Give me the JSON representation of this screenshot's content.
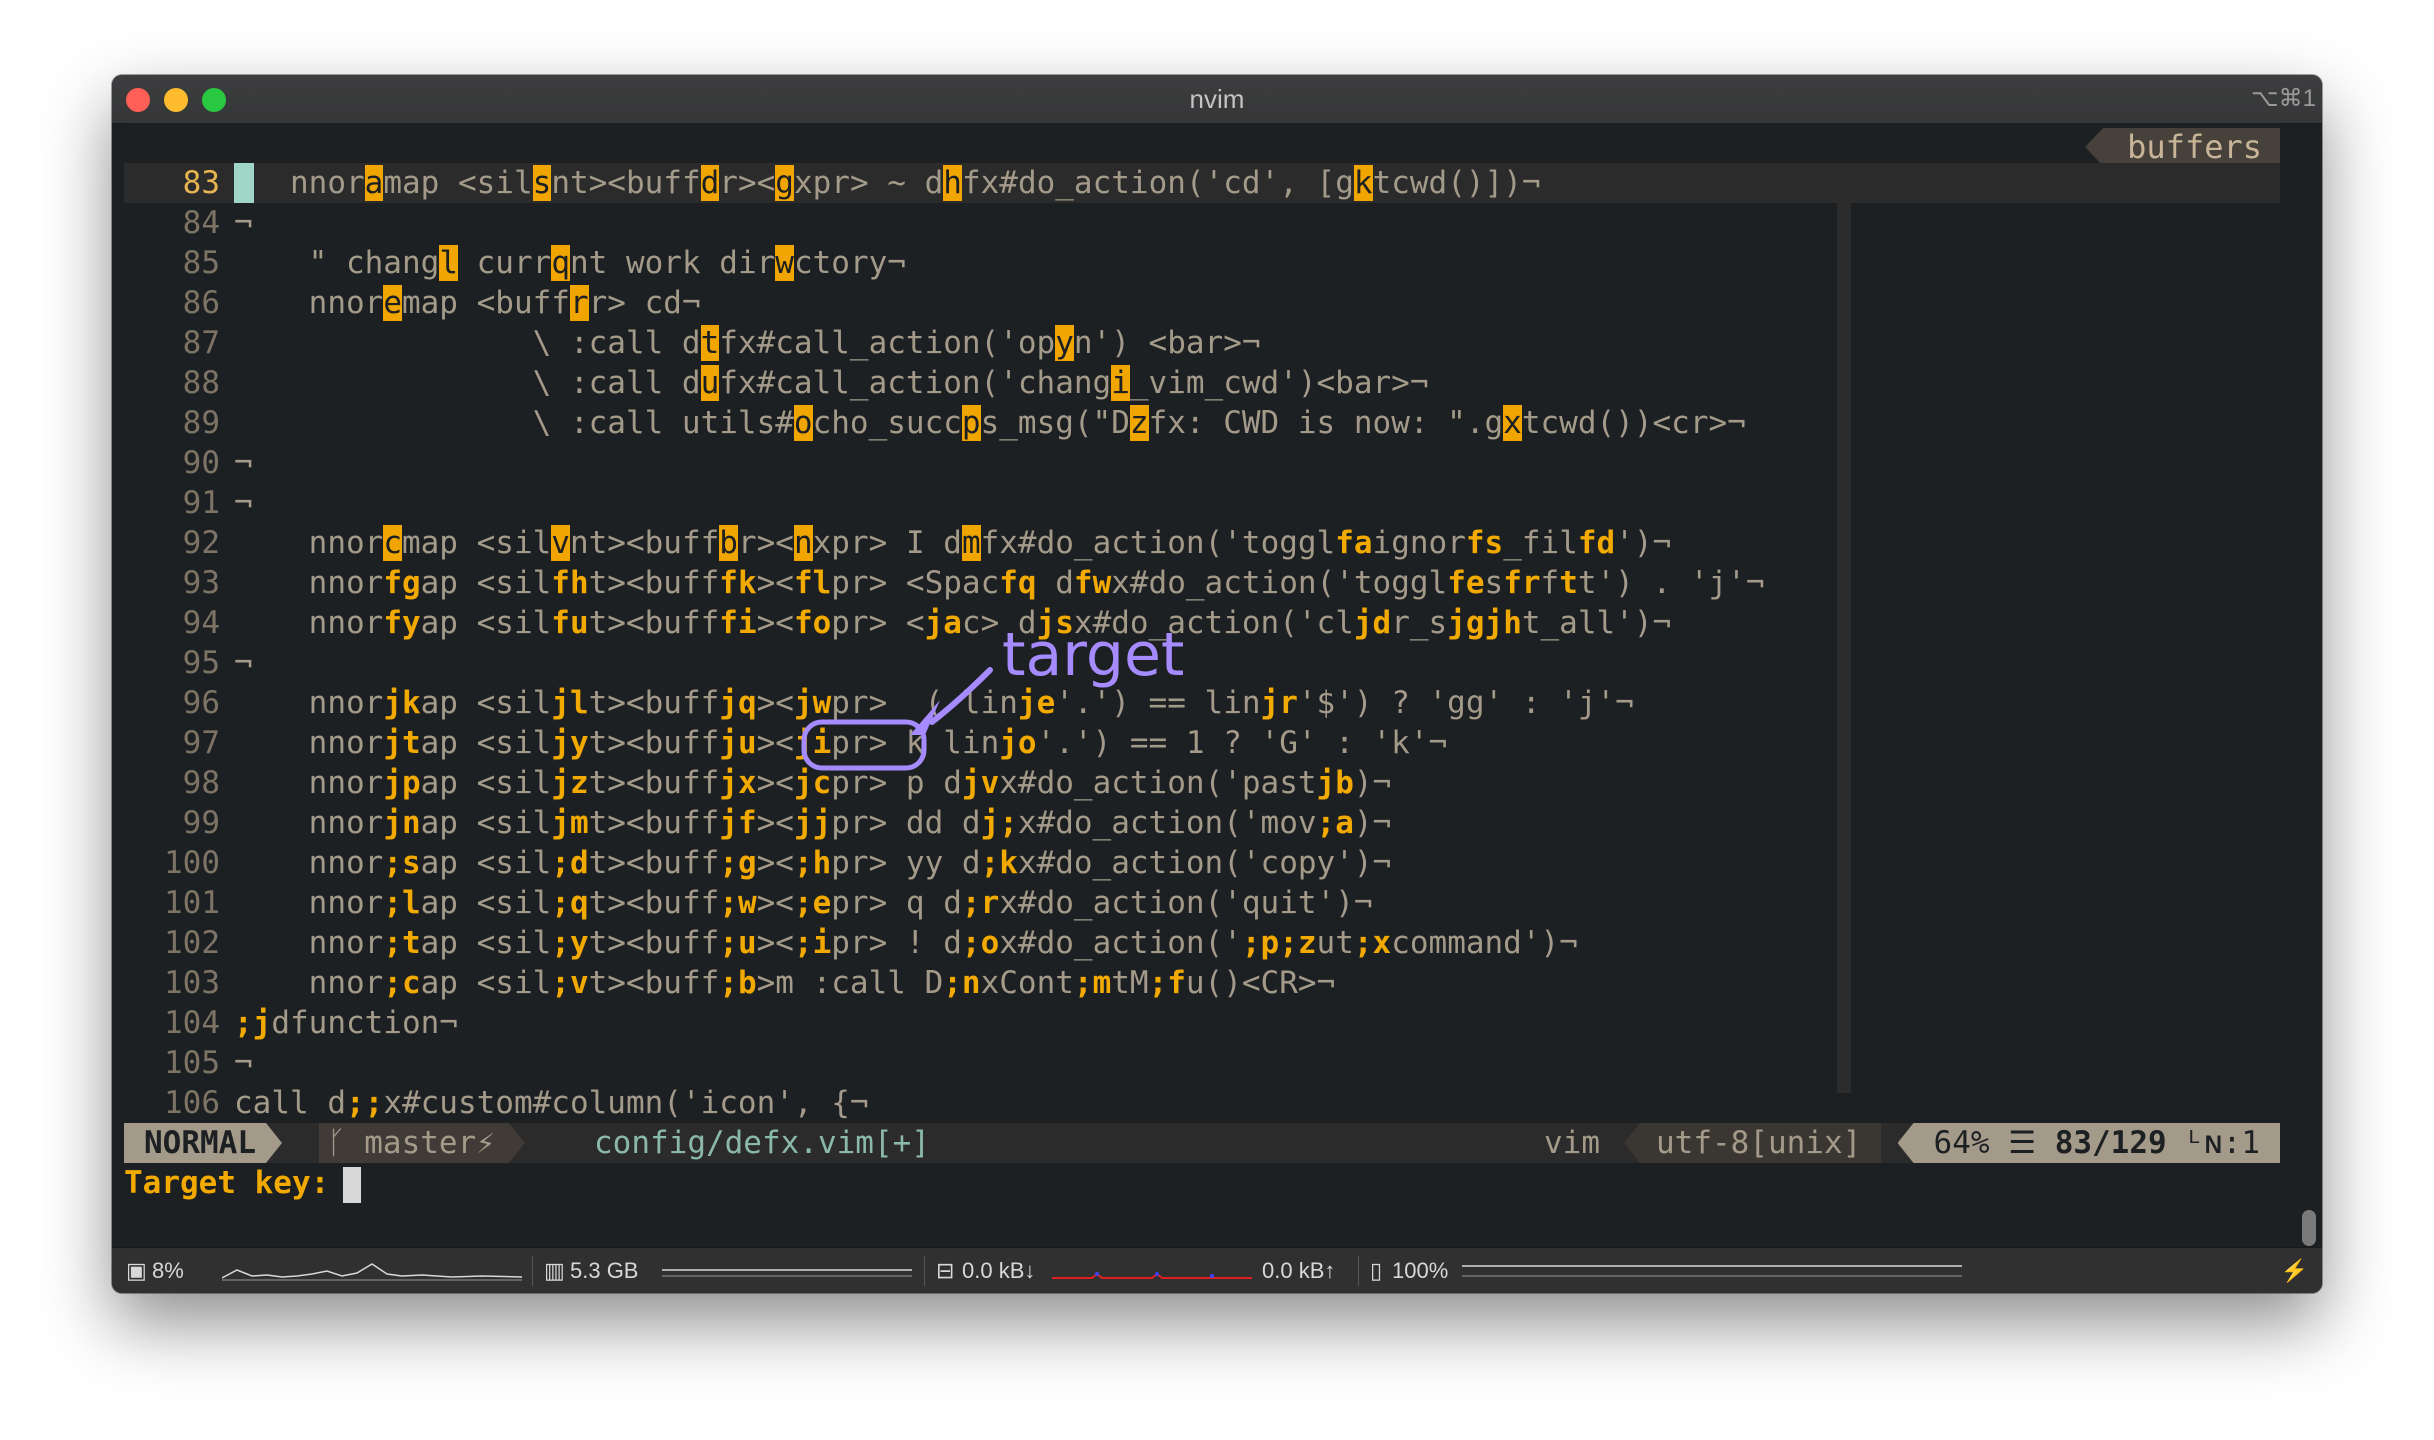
{
  "window": {
    "title": "nvim",
    "shortcut": "⌥⌘1",
    "traffic_lights": {
      "close": "#ff5f57",
      "minimize": "#febc2e",
      "maximize": "#28c840"
    }
  },
  "tabline": {
    "buffers_label": "buffers"
  },
  "editor": {
    "lines": [
      {
        "n": "83",
        "current": true,
        "segs": [
          [
            "   nnor",
            ""
          ],
          [
            "a",
            "hl"
          ],
          [
            "map ",
            ""
          ],
          [
            "<sil",
            ""
          ],
          [
            "s",
            "hl"
          ],
          [
            "nt><buff",
            ""
          ],
          [
            "d",
            "hl"
          ],
          [
            "r><",
            ""
          ],
          [
            "g",
            "hl"
          ],
          [
            "xpr> ~ d",
            ""
          ],
          [
            "h",
            "hl"
          ],
          [
            "fx#do_action('cd', [g",
            ""
          ],
          [
            "k",
            "hl"
          ],
          [
            "tcwd()])¬",
            ""
          ]
        ]
      },
      {
        "n": "84",
        "segs": [
          [
            "¬",
            ""
          ]
        ]
      },
      {
        "n": "85",
        "segs": [
          [
            "    \" chang",
            ""
          ],
          [
            "l",
            "hl"
          ],
          [
            " curr",
            ""
          ],
          [
            "q",
            "hl"
          ],
          [
            "nt work dir",
            ""
          ],
          [
            "w",
            "hl"
          ],
          [
            "ctory¬",
            ""
          ]
        ]
      },
      {
        "n": "86",
        "segs": [
          [
            "    nnor",
            ""
          ],
          [
            "e",
            "hl"
          ],
          [
            "map <buff",
            ""
          ],
          [
            "r",
            "hl"
          ],
          [
            "r> cd¬",
            ""
          ]
        ]
      },
      {
        "n": "87",
        "segs": [
          [
            "                \\ :call d",
            ""
          ],
          [
            "t",
            "hl"
          ],
          [
            "fx#call_action('op",
            ""
          ],
          [
            "y",
            "hl"
          ],
          [
            "n') <bar>¬",
            ""
          ]
        ]
      },
      {
        "n": "88",
        "segs": [
          [
            "                \\ :call d",
            ""
          ],
          [
            "u",
            "hl"
          ],
          [
            "fx#call_action('chang",
            ""
          ],
          [
            "i",
            "hl"
          ],
          [
            "_vim_cwd')<bar>¬",
            ""
          ]
        ]
      },
      {
        "n": "89",
        "segs": [
          [
            "                \\ :call utils#",
            ""
          ],
          [
            "o",
            "hl"
          ],
          [
            "cho_succ",
            ""
          ],
          [
            "p",
            "hl"
          ],
          [
            "s_msg(\"D",
            ""
          ],
          [
            "z",
            "hl"
          ],
          [
            "fx: CWD is now: \".g",
            ""
          ],
          [
            "x",
            "hl"
          ],
          [
            "tcwd())<cr>¬",
            ""
          ]
        ]
      },
      {
        "n": "90",
        "segs": [
          [
            "¬",
            ""
          ]
        ]
      },
      {
        "n": "91",
        "segs": [
          [
            "¬",
            ""
          ]
        ]
      },
      {
        "n": "92",
        "segs": [
          [
            "    nnor",
            ""
          ],
          [
            "c",
            "hl"
          ],
          [
            "map <sil",
            ""
          ],
          [
            "v",
            "hl"
          ],
          [
            "nt><buff",
            ""
          ],
          [
            "b",
            "hl"
          ],
          [
            "r><",
            ""
          ],
          [
            "n",
            "hl"
          ],
          [
            "xpr> I d",
            ""
          ],
          [
            "m",
            "hl"
          ],
          [
            "fx#do_action('toggl",
            ""
          ],
          [
            "fa",
            "lb"
          ],
          [
            "ignor",
            ""
          ],
          [
            "fs",
            "lb"
          ],
          [
            "_fil",
            ""
          ],
          [
            "fd",
            "lb"
          ],
          [
            "')¬",
            ""
          ]
        ]
      },
      {
        "n": "93",
        "segs": [
          [
            "    nnor",
            ""
          ],
          [
            "fg",
            "lb"
          ],
          [
            "ap <sil",
            ""
          ],
          [
            "fh",
            "lb"
          ],
          [
            "t><buff",
            ""
          ],
          [
            "fk",
            "lb"
          ],
          [
            "><",
            ""
          ],
          [
            "fl",
            "lb"
          ],
          [
            "pr> <Spac",
            ""
          ],
          [
            "fq",
            "lb"
          ],
          [
            " d",
            ""
          ],
          [
            "fw",
            "lb"
          ],
          [
            "x#do_action('toggl",
            ""
          ],
          [
            "fe",
            "lb"
          ],
          [
            "s",
            ""
          ],
          [
            "fr",
            "lb"
          ],
          [
            "f",
            ""
          ],
          [
            "t",
            "lb"
          ],
          [
            "t') . 'j'¬",
            ""
          ]
        ]
      },
      {
        "n": "94",
        "segs": [
          [
            "    nnor",
            ""
          ],
          [
            "fy",
            "lb"
          ],
          [
            "ap <sil",
            ""
          ],
          [
            "fu",
            "lb"
          ],
          [
            "t><buff",
            ""
          ],
          [
            "fi",
            "lb"
          ],
          [
            "><",
            ""
          ],
          [
            "fo",
            "lb"
          ],
          [
            "pr> <",
            ""
          ],
          [
            "ja",
            "lb"
          ],
          [
            "c> d",
            ""
          ],
          [
            "js",
            "lb"
          ],
          [
            "x#do_action('cl",
            ""
          ],
          [
            "jd",
            "lb"
          ],
          [
            "r_s",
            ""
          ],
          [
            "jg",
            "lb"
          ],
          [
            "",
            ""
          ],
          [
            "jh",
            "lb"
          ],
          [
            "t_all')¬",
            ""
          ]
        ]
      },
      {
        "n": "95",
        "segs": [
          [
            "¬",
            ""
          ]
        ]
      },
      {
        "n": "96",
        "segs": [
          [
            "    nnor",
            ""
          ],
          [
            "jk",
            "lb"
          ],
          [
            "ap <sil",
            ""
          ],
          [
            "jl",
            "lb"
          ],
          [
            "t><buff",
            ""
          ],
          [
            "jq",
            "lb"
          ],
          [
            "><",
            ""
          ],
          [
            "jw",
            "lb"
          ],
          [
            "pr>  ( lin",
            ""
          ],
          [
            "je",
            "lb"
          ],
          [
            "'.') == lin",
            ""
          ],
          [
            "jr",
            "lb"
          ],
          [
            "'$') ? 'gg' : 'j'¬",
            ""
          ]
        ]
      },
      {
        "n": "97",
        "segs": [
          [
            "    nnor",
            ""
          ],
          [
            "jt",
            "lb"
          ],
          [
            "ap <sil",
            ""
          ],
          [
            "jy",
            "lb"
          ],
          [
            "t><buff",
            ""
          ],
          [
            "ju",
            "lb"
          ],
          [
            "><",
            ""
          ],
          [
            "ji",
            "lb"
          ],
          [
            "pr> k lin",
            ""
          ],
          [
            "jo",
            "lb"
          ],
          [
            "'.') == 1 ? 'G' : 'k'¬",
            ""
          ]
        ]
      },
      {
        "n": "98",
        "segs": [
          [
            "    nnor",
            ""
          ],
          [
            "jp",
            "lb"
          ],
          [
            "ap <sil",
            ""
          ],
          [
            "jz",
            "lb"
          ],
          [
            "t><buff",
            ""
          ],
          [
            "jx",
            "lb"
          ],
          [
            "><",
            ""
          ],
          [
            "jc",
            "lb"
          ],
          [
            "pr> p d",
            ""
          ],
          [
            "jv",
            "lb"
          ],
          [
            "x#do_action('past",
            ""
          ],
          [
            "jb",
            "lb"
          ],
          [
            ")¬",
            ""
          ]
        ]
      },
      {
        "n": "99",
        "segs": [
          [
            "    nnor",
            ""
          ],
          [
            "jn",
            "lb"
          ],
          [
            "ap <sil",
            ""
          ],
          [
            "jm",
            "lb"
          ],
          [
            "t><buff",
            ""
          ],
          [
            "jf",
            "lb"
          ],
          [
            "><",
            ""
          ],
          [
            "jj",
            "lb"
          ],
          [
            "pr> dd d",
            ""
          ],
          [
            "j;",
            "lb"
          ],
          [
            "x#do_action('mov",
            ""
          ],
          [
            ";a",
            "lb"
          ],
          [
            ")¬",
            ""
          ]
        ]
      },
      {
        "n": "100",
        "segs": [
          [
            "    nnor",
            ""
          ],
          [
            ";s",
            "lb"
          ],
          [
            "ap <sil",
            ""
          ],
          [
            ";d",
            "lb"
          ],
          [
            "t><buff",
            ""
          ],
          [
            ";g",
            "lb"
          ],
          [
            "><",
            ""
          ],
          [
            ";h",
            "lb"
          ],
          [
            "pr> yy d",
            ""
          ],
          [
            ";k",
            "lb"
          ],
          [
            "x#do_action('copy')¬",
            ""
          ]
        ]
      },
      {
        "n": "101",
        "segs": [
          [
            "    nnor",
            ""
          ],
          [
            ";l",
            "lb"
          ],
          [
            "ap <sil",
            ""
          ],
          [
            ";q",
            "lb"
          ],
          [
            "t><buff",
            ""
          ],
          [
            ";w",
            "lb"
          ],
          [
            "><",
            ""
          ],
          [
            ";e",
            "lb"
          ],
          [
            "pr> q d",
            ""
          ],
          [
            ";r",
            "lb"
          ],
          [
            "x#do_action('quit')¬",
            ""
          ]
        ]
      },
      {
        "n": "102",
        "segs": [
          [
            "    nnor",
            ""
          ],
          [
            ";t",
            "lb"
          ],
          [
            "ap <sil",
            ""
          ],
          [
            ";y",
            "lb"
          ],
          [
            "t><buff",
            ""
          ],
          [
            ";u",
            "lb"
          ],
          [
            "><",
            ""
          ],
          [
            ";i",
            "lb"
          ],
          [
            "pr> ! d",
            ""
          ],
          [
            ";o",
            "lb"
          ],
          [
            "x#do_action('",
            ""
          ],
          [
            ";p",
            "lb"
          ],
          [
            "",
            ""
          ],
          [
            ";z",
            "lb"
          ],
          [
            "ut",
            ""
          ],
          [
            ";x",
            "lb"
          ],
          [
            "command')¬",
            ""
          ]
        ]
      },
      {
        "n": "103",
        "segs": [
          [
            "    nnor",
            ""
          ],
          [
            ";c",
            "lb"
          ],
          [
            "ap <sil",
            ""
          ],
          [
            ";v",
            "lb"
          ],
          [
            "t><buff",
            ""
          ],
          [
            ";b",
            "lb"
          ],
          [
            ">m :call D",
            ""
          ],
          [
            ";n",
            "lb"
          ],
          [
            "xCont",
            ""
          ],
          [
            ";m",
            "lb"
          ],
          [
            "tM",
            ""
          ],
          [
            ";f",
            "lb"
          ],
          [
            "u()<CR>¬",
            ""
          ]
        ]
      },
      {
        "n": "104",
        "segs": [
          [
            ";j",
            "lb"
          ],
          [
            "dfunction¬",
            ""
          ]
        ]
      },
      {
        "n": "105",
        "segs": [
          [
            "¬",
            ""
          ]
        ]
      },
      {
        "n": "106",
        "segs": [
          [
            "call d",
            ""
          ],
          [
            ";;",
            "lb"
          ],
          [
            "x#custom#column('icon', {¬",
            ""
          ]
        ]
      }
    ]
  },
  "statusline": {
    "mode": "NORMAL",
    "branch": "ᚴ master⚡",
    "file": "config/defx.vim[+]",
    "filetype": "vim",
    "encoding": "utf-8[unix]",
    "percent": "64%",
    "position": "83/129",
    "column": ":1"
  },
  "cmdline": {
    "prompt": "Target key:"
  },
  "annotation": {
    "label": "target",
    "color": "#a58bff"
  },
  "bottombar": {
    "cpu": "8%",
    "memory": "5.3 GB",
    "net_down": "0.0 kB↓",
    "net_up": "0.0 kB↑",
    "battery": "100%",
    "power": "⚡"
  }
}
